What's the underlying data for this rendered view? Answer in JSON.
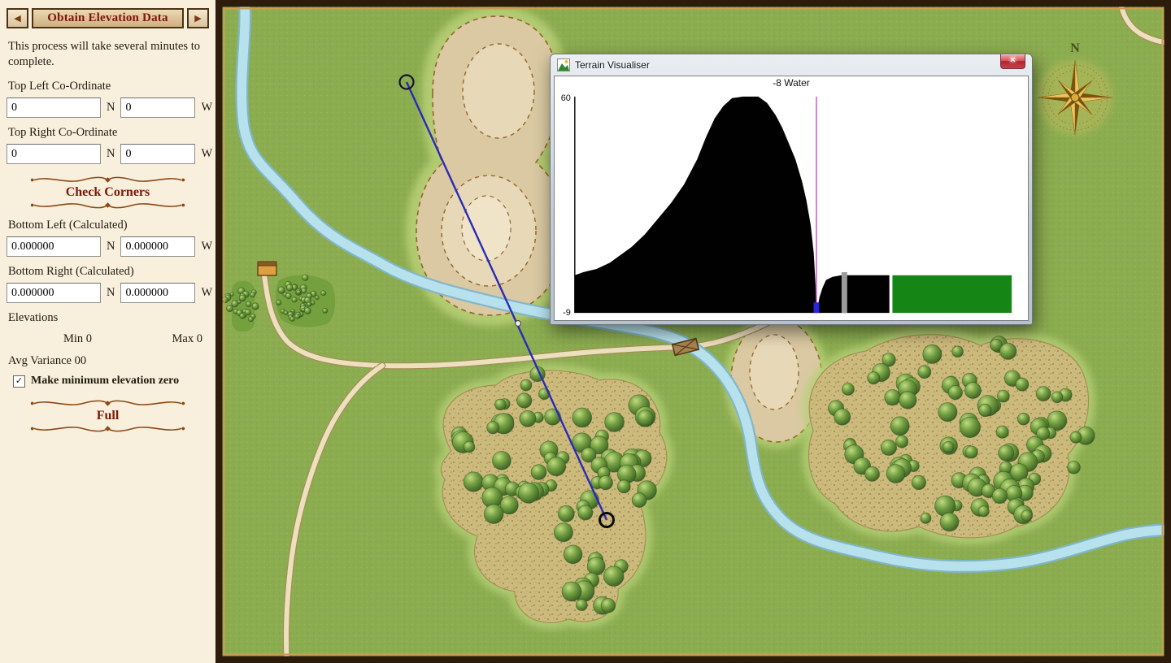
{
  "sidebar": {
    "nav_prev_glyph": "◀",
    "nav_next_glyph": "▶",
    "title": "Obtain Elevation Data",
    "intro": "This process will take several minutes to complete.",
    "top_left_label": "Top Left Co-Ordinate",
    "top_right_label": "Top Right Co-Ordinate",
    "coord_n_label": "N",
    "coord_w_label": "W",
    "top_left_n": "0",
    "top_left_w": "0",
    "top_right_n": "0",
    "top_right_w": "0",
    "check_corners_label": "Check Corners",
    "bottom_left_label": "Bottom Left (Calculated)",
    "bottom_right_label": "Bottom Right (Calculated)",
    "bottom_left_n": "0.000000",
    "bottom_left_w": "0.000000",
    "bottom_right_n": "0.000000",
    "bottom_right_w": "0.000000",
    "elevations_label": "Elevations",
    "min_label": "Min 0",
    "max_label": "Max 0",
    "avg_variance_label": "Avg Variance 00",
    "checkbox_label": "Make minimum elevation zero",
    "checkbox_checked": true,
    "checkbox_glyph": "✓",
    "full_label": "Full"
  },
  "map": {
    "compass_label": "N"
  },
  "visualiser": {
    "window_title": "Terrain Visualiser",
    "close_glyph": "✕",
    "chart_data": {
      "type": "area",
      "title": "-8 Water",
      "xlabel": "",
      "ylabel": "",
      "ylim": [
        -9,
        60
      ],
      "y_top_label": "60",
      "y_bottom_label": "-9",
      "grid": false,
      "legend": false,
      "profile": [
        [
          0,
          3
        ],
        [
          0.02,
          4
        ],
        [
          0.05,
          5
        ],
        [
          0.08,
          7
        ],
        [
          0.1,
          9
        ],
        [
          0.13,
          12
        ],
        [
          0.16,
          16
        ],
        [
          0.19,
          21
        ],
        [
          0.22,
          26
        ],
        [
          0.25,
          32
        ],
        [
          0.28,
          40
        ],
        [
          0.3,
          47
        ],
        [
          0.32,
          53
        ],
        [
          0.34,
          57
        ],
        [
          0.36,
          59.5
        ],
        [
          0.385,
          60
        ],
        [
          0.42,
          60
        ],
        [
          0.44,
          58
        ],
        [
          0.46,
          54
        ],
        [
          0.475,
          50
        ],
        [
          0.49,
          45
        ],
        [
          0.505,
          40
        ],
        [
          0.52,
          33
        ],
        [
          0.53,
          27
        ],
        [
          0.54,
          19
        ],
        [
          0.547,
          10
        ],
        [
          0.551,
          0
        ],
        [
          0.553,
          -9
        ],
        [
          0.556,
          -7
        ],
        [
          0.56,
          -4
        ],
        [
          0.567,
          -1
        ],
        [
          0.575,
          1.5
        ],
        [
          0.59,
          2.5
        ],
        [
          0.61,
          3
        ],
        [
          0.64,
          3
        ],
        [
          0.67,
          3
        ],
        [
          0.7,
          3
        ],
        [
          0.72,
          3
        ]
      ],
      "cursor_frac": 0.553,
      "cursor_color": "#cf49c4",
      "cursor_value": -8,
      "cursor_surface": "Water",
      "marker_frac": 0.553,
      "marker_color": "#2626dd",
      "gray_bar": {
        "frac": 0.617,
        "elev": 4,
        "color": "#9c9c9c"
      },
      "water": {
        "start_frac": 0.727,
        "end_frac": 1.0,
        "elev": 3,
        "color": "#158515"
      }
    }
  }
}
